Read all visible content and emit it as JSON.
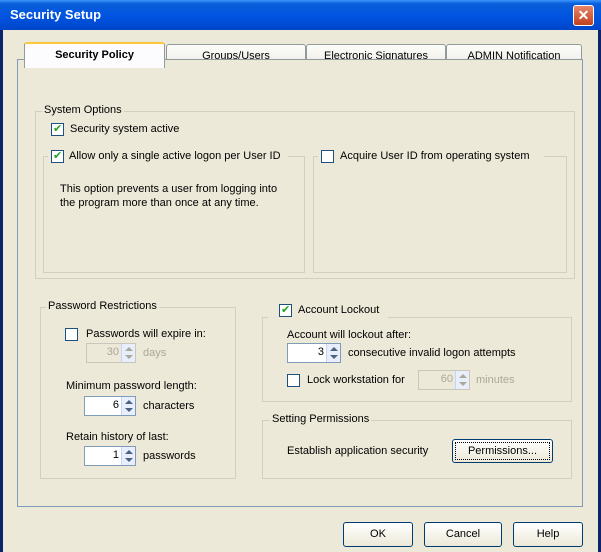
{
  "window": {
    "title": "Security Setup"
  },
  "tabs": [
    {
      "label": "Security Policy"
    },
    {
      "label": "Groups/Users"
    },
    {
      "label": "Electronic Signatures"
    },
    {
      "label": "ADMIN Notification"
    }
  ],
  "system_options": {
    "group_label": "System Options",
    "security_active_label": "Security system active",
    "security_active_checked": true,
    "single_logon_label": "Allow only a single active logon per User ID",
    "single_logon_checked": true,
    "single_logon_desc_line1": "This option prevents a user from logging into",
    "single_logon_desc_line2": "the program more than once at any time.",
    "acquire_userid_label": "Acquire User ID from operating system",
    "acquire_userid_checked": false
  },
  "password_restrictions": {
    "group_label": "Password Restrictions",
    "expire_label": "Passwords will expire in:",
    "expire_checked": false,
    "expire_value": "30",
    "expire_unit": "days",
    "min_length_label": "Minimum password length:",
    "min_length_value": "6",
    "min_length_unit": "characters",
    "history_label": "Retain history of last:",
    "history_value": "1",
    "history_unit": "passwords"
  },
  "account_lockout": {
    "group_label": "Account Lockout",
    "checked": true,
    "after_label": "Account will lockout after:",
    "attempts_value": "3",
    "attempts_unit": "consecutive invalid logon attempts",
    "lock_workstation_label": "Lock workstation for",
    "lock_workstation_checked": false,
    "minutes_value": "60",
    "minutes_unit": "minutes"
  },
  "setting_permissions": {
    "group_label": "Setting Permissions",
    "establish_label": "Establish application security",
    "permissions_button": "Permissions..."
  },
  "footer": {
    "ok": "OK",
    "cancel": "Cancel",
    "help": "Help"
  },
  "colors": {
    "title_bar": "#0053e1",
    "dialog_bg": "#ece9d8",
    "checkmark": "#21a121"
  }
}
